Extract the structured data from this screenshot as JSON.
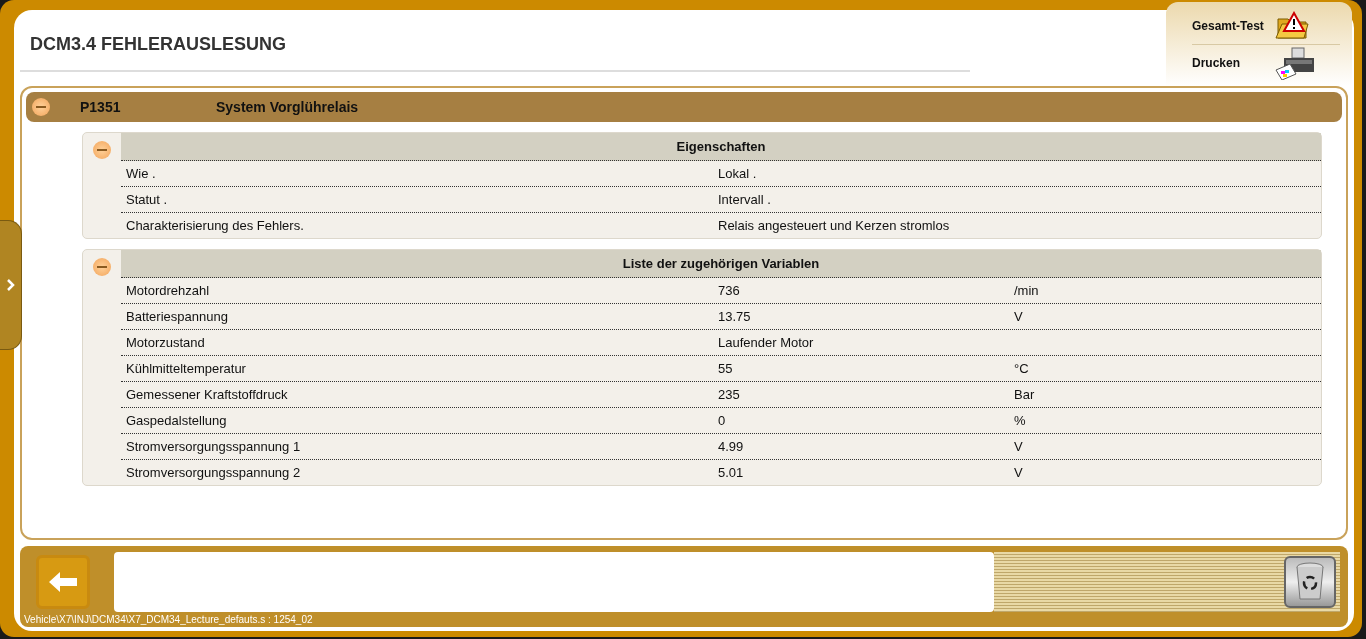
{
  "title": "DCM3.4  FEHLERAUSLESUNG",
  "actions": [
    {
      "label": "Gesamt-Test",
      "kind": "test"
    },
    {
      "label": "Drucken",
      "kind": "print"
    }
  ],
  "fault": {
    "code": "P1351",
    "description": "System Vorglührelais",
    "expanded": true,
    "sections": [
      {
        "title": "Eigenschaften",
        "expanded": true,
        "rows": [
          [
            "Wie .",
            "Lokal ."
          ],
          [
            "Statut .",
            "Intervall ."
          ],
          [
            "Charakterisierung des Fehlers.",
            "Relais angesteuert und Kerzen stromlos"
          ]
        ]
      },
      {
        "title": "Liste der zugehörigen Variablen",
        "expanded": true,
        "rows": [
          [
            "Motordrehzahl",
            "736",
            "/min"
          ],
          [
            "Batteriespannung",
            "13.75",
            "V"
          ],
          [
            "Motorzustand",
            "Laufender Motor"
          ],
          [
            "Kühlmitteltemperatur",
            "55",
            "°C"
          ],
          [
            "Gemessener Kraftstoffdruck",
            "235",
            "Bar"
          ],
          [
            "Gaspedalstellung",
            "0",
            "%"
          ],
          [
            "Stromversorgungsspannung 1",
            "4.99",
            "V"
          ],
          [
            "Stromversorgungsspannung 2",
            "5.01",
            "V"
          ]
        ]
      }
    ]
  },
  "status_path": "Vehicle\\X7\\INJ\\DCM34\\X7_DCM34_Lecture_defauts.s : 1254_02"
}
